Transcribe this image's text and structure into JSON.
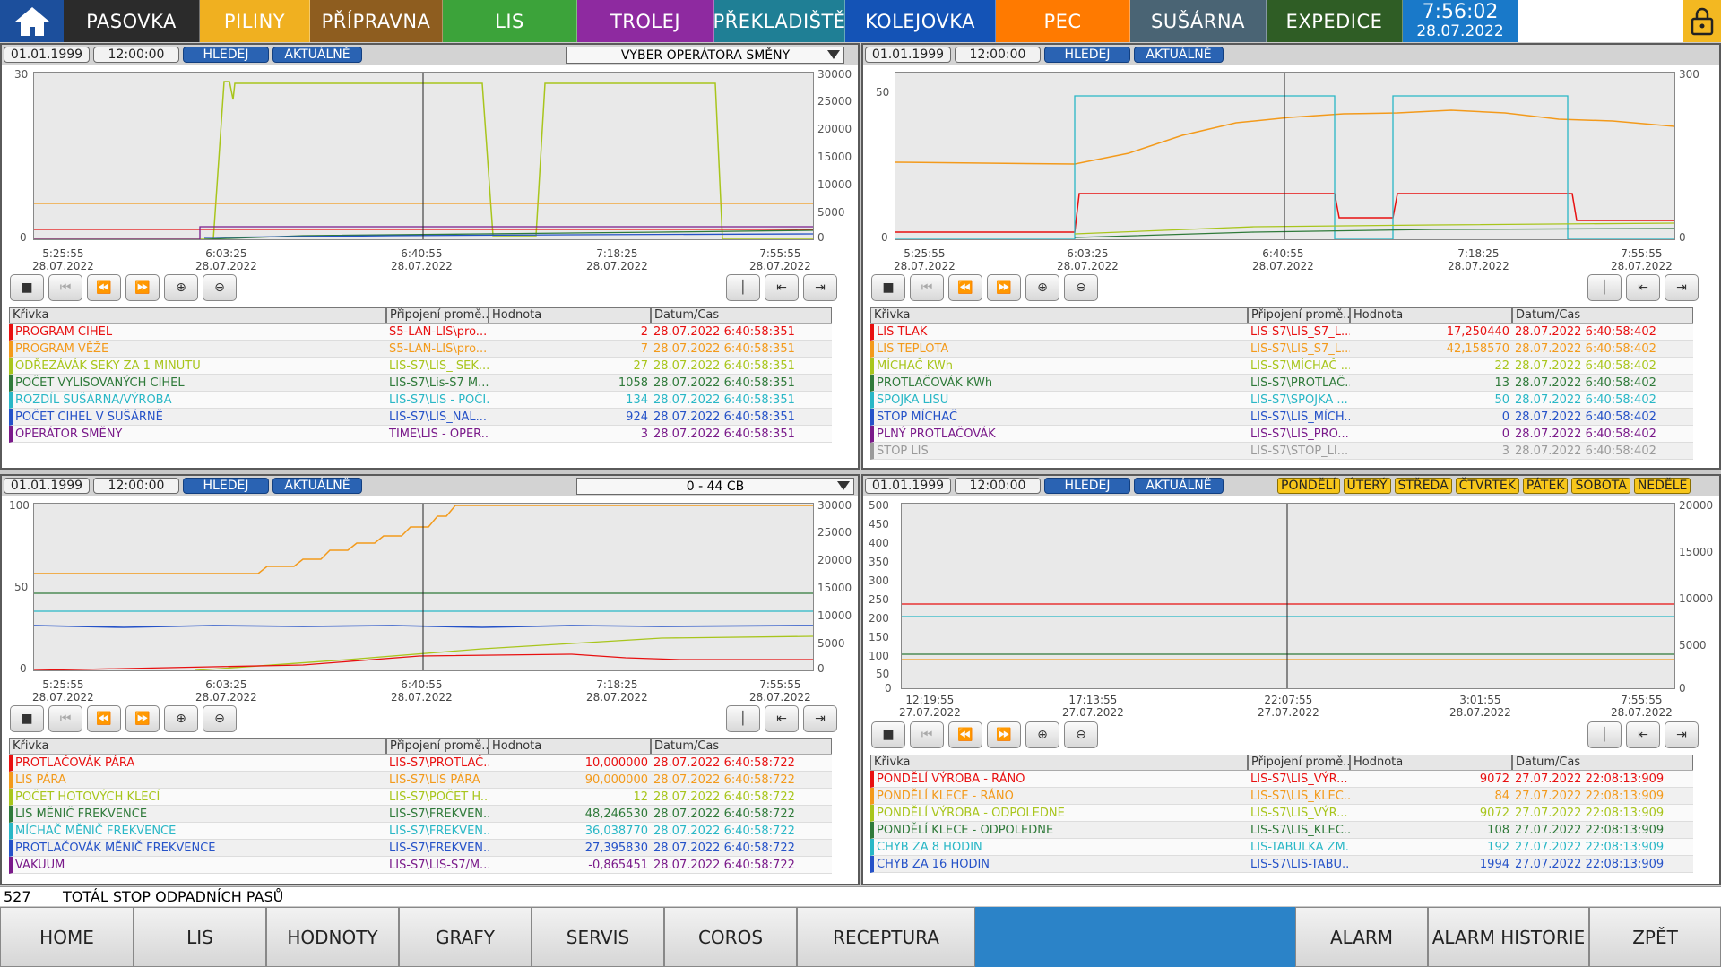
{
  "nav": {
    "tabs": [
      {
        "label": "PASOVKA",
        "color": "#2b2b2b"
      },
      {
        "label": "PILINY",
        "color": "#f0b020"
      },
      {
        "label": "PŘÍPRAVNA",
        "color": "#8e5d1f"
      },
      {
        "label": "LIS",
        "color": "#3ca33a"
      },
      {
        "label": "TROLEJ",
        "color": "#8e2aa0"
      },
      {
        "label": "PŘEKLADIŠTĚ",
        "color": "#1f7f95"
      },
      {
        "label": "KOLEJOVKA",
        "color": "#1453b6"
      },
      {
        "label": "PEC",
        "color": "#ff7a00"
      },
      {
        "label": "SUŠÁRNA",
        "color": "#4a6474"
      },
      {
        "label": "EXPEDICE",
        "color": "#2f5d25"
      }
    ],
    "time": "7:56:02",
    "date": "28.07.2022"
  },
  "panels": [
    {
      "date": "01.01.1999",
      "time": "12:00:00",
      "search": "HLEDEJ",
      "current": "AKTUÁLNĚ",
      "combo": "VYBER OPERÁTORA SMĚNY",
      "yleft": [
        "30",
        "0"
      ],
      "yright": [
        "30000",
        "25000",
        "20000",
        "15000",
        "10000",
        "5000",
        "0"
      ],
      "xticks": [
        {
          "t": "5:25:55",
          "d": "28.07.2022"
        },
        {
          "t": "6:03:25",
          "d": "28.07.2022"
        },
        {
          "t": "6:40:55",
          "d": "28.07.2022"
        },
        {
          "t": "7:18:25",
          "d": "28.07.2022"
        },
        {
          "t": "7:55:55",
          "d": "28.07.2022"
        }
      ],
      "headers": [
        "Křivka",
        "Připojení promě...",
        "Hodnota",
        "Datum/Čas"
      ],
      "rows": [
        {
          "name": "PROGRAM CIHEL",
          "conn": "S5-LAN-LIS\\pro...",
          "val": "2",
          "dt": "28.07.2022 6:40:58:351",
          "color": "#e81010"
        },
        {
          "name": "PROGRAM VĚŽE",
          "conn": "S5-LAN-LIS\\pro...",
          "val": "7",
          "dt": "28.07.2022 6:40:58:351",
          "color": "#f39a1b"
        },
        {
          "name": "ODŘEZÁVÁK SEKY ZA 1 MINUTU",
          "conn": "LIS-S7\\LIS_ SEK...",
          "val": "27",
          "dt": "28.07.2022 6:40:58:351",
          "color": "#a8c51c"
        },
        {
          "name": "POČET VYLISOVANÝCH CIHEL",
          "conn": "LIS-S7\\Lis-S7 M...",
          "val": "1058",
          "dt": "28.07.2022 6:40:58:351",
          "color": "#2f7a3a"
        },
        {
          "name": "ROZDÍL SUŠÁRNA/VÝROBA",
          "conn": "LIS-S7\\LIS - POČI...",
          "val": "134",
          "dt": "28.07.2022 6:40:58:351",
          "color": "#29b7c6"
        },
        {
          "name": "POČET CIHEL V SUŠÁRNĚ",
          "conn": "LIS-S7\\LIS_NAL...",
          "val": "924",
          "dt": "28.07.2022 6:40:58:351",
          "color": "#2552c8"
        },
        {
          "name": "OPERÁTOR SMĚNY",
          "conn": "TIME\\LIS - OPER...",
          "val": "3",
          "dt": "28.07.2022 6:40:58:351",
          "color": "#7a1a8a"
        }
      ]
    },
    {
      "date": "01.01.1999",
      "time": "12:00:00",
      "search": "HLEDEJ",
      "current": "AKTUÁLNĚ",
      "yleft": [
        "50",
        "0"
      ],
      "yright": [
        "300",
        "0"
      ],
      "xticks": [
        {
          "t": "5:25:55",
          "d": "28.07.2022"
        },
        {
          "t": "6:03:25",
          "d": "28.07.2022"
        },
        {
          "t": "6:40:55",
          "d": "28.07.2022"
        },
        {
          "t": "7:18:25",
          "d": "28.07.2022"
        },
        {
          "t": "7:55:55",
          "d": "28.07.2022"
        }
      ],
      "headers": [
        "Křivka",
        "Připojení promě...",
        "Hodnota",
        "Datum/Čas"
      ],
      "rows": [
        {
          "name": "LIS TLAK",
          "conn": "LIS-S7\\LIS_S7_L...",
          "val": "17,250440",
          "dt": "28.07.2022 6:40:58:402",
          "color": "#e81010"
        },
        {
          "name": "LIS TEPLOTA",
          "conn": "LIS-S7\\LIS_S7_L...",
          "val": "42,158570",
          "dt": "28.07.2022 6:40:58:402",
          "color": "#f39a1b"
        },
        {
          "name": "MÍCHAČ KWh",
          "conn": "LIS-S7\\MÍCHAČ ...",
          "val": "22",
          "dt": "28.07.2022 6:40:58:402",
          "color": "#a8c51c"
        },
        {
          "name": "PROTLAČOVÁK KWh",
          "conn": "LIS-S7\\PROTLAČ...",
          "val": "13",
          "dt": "28.07.2022 6:40:58:402",
          "color": "#2f7a3a"
        },
        {
          "name": "SPOJKA LISU",
          "conn": "LIS-S7\\SPOJKA ...",
          "val": "50",
          "dt": "28.07.2022 6:40:58:402",
          "color": "#29b7c6"
        },
        {
          "name": "STOP MÍCHAČ",
          "conn": "LIS-S7\\LIS_MÍCH...",
          "val": "0",
          "dt": "28.07.2022 6:40:58:402",
          "color": "#2552c8"
        },
        {
          "name": "PLNÝ PROTLAČOVÁK",
          "conn": "LIS-S7\\LIS_PRO...",
          "val": "0",
          "dt": "28.07.2022 6:40:58:402",
          "color": "#7a1a8a"
        },
        {
          "name": "STOP LIS",
          "conn": "LIS-S7\\STOP_LI...",
          "val": "3",
          "dt": "28.07.2022 6:40:58:402",
          "color": "#9a9a9a"
        }
      ]
    },
    {
      "date": "01.01.1999",
      "time": "12:00:00",
      "search": "HLEDEJ",
      "current": "AKTUÁLNĚ",
      "combo": "0 - 44 CB",
      "yleft": [
        "100",
        "50",
        "0"
      ],
      "yright": [
        "30000",
        "25000",
        "20000",
        "15000",
        "10000",
        "5000",
        "0"
      ],
      "xticks": [
        {
          "t": "5:25:55",
          "d": "28.07.2022"
        },
        {
          "t": "6:03:25",
          "d": "28.07.2022"
        },
        {
          "t": "6:40:55",
          "d": "28.07.2022"
        },
        {
          "t": "7:18:25",
          "d": "28.07.2022"
        },
        {
          "t": "7:55:55",
          "d": "28.07.2022"
        }
      ],
      "headers": [
        "Křivka",
        "Připojení promě...",
        "Hodnota",
        "Datum/Čas"
      ],
      "rows": [
        {
          "name": "PROTLAČOVÁK PÁRA",
          "conn": "LIS-S7\\PROTLAČ...",
          "val": "10,000000",
          "dt": "28.07.2022 6:40:58:722",
          "color": "#e81010"
        },
        {
          "name": "LIS PÁRA",
          "conn": "LIS-S7\\LIS PÁRA",
          "val": "90,000000",
          "dt": "28.07.2022 6:40:58:722",
          "color": "#f39a1b"
        },
        {
          "name": "POČET HOTOVÝCH KLECÍ",
          "conn": "LIS-S7\\POČET H...",
          "val": "12",
          "dt": "28.07.2022 6:40:58:722",
          "color": "#a8c51c"
        },
        {
          "name": "LIS MĚNIČ FREKVENCE",
          "conn": "LIS-S7\\FREKVEN...",
          "val": "48,246530",
          "dt": "28.07.2022 6:40:58:722",
          "color": "#2f7a3a"
        },
        {
          "name": "MÍCHAČ MĚNIČ FREKVENCE",
          "conn": "LIS-S7\\FREKVEN...",
          "val": "36,038770",
          "dt": "28.07.2022 6:40:58:722",
          "color": "#29b7c6"
        },
        {
          "name": "PROTLAČOVÁK MĚNIČ FREKVENCE",
          "conn": "LIS-S7\\FREKVEN...",
          "val": "27,395830",
          "dt": "28.07.2022 6:40:58:722",
          "color": "#2552c8"
        },
        {
          "name": "VAKUUM",
          "conn": "LIS-S7\\LIS-S7/M...",
          "val": "-0,865451",
          "dt": "28.07.2022 6:40:58:722",
          "color": "#7a1a8a"
        }
      ]
    },
    {
      "date": "01.01.1999",
      "time": "12:00:00",
      "search": "HLEDEJ",
      "current": "AKTUÁLNĚ",
      "days": [
        "PONDĚLÍ",
        "ÚTERÝ",
        "STŘEDA",
        "ČTVRTEK",
        "PÁTEK",
        "SOBOTA",
        "NEDĚLE"
      ],
      "yleft": [
        "500",
        "450",
        "400",
        "350",
        "300",
        "250",
        "200",
        "150",
        "100",
        "50",
        "0"
      ],
      "yright": [
        "20000",
        "15000",
        "10000",
        "5000",
        "0"
      ],
      "xticks": [
        {
          "t": "12:19:55",
          "d": "27.07.2022"
        },
        {
          "t": "17:13:55",
          "d": "27.07.2022"
        },
        {
          "t": "22:07:55",
          "d": "27.07.2022"
        },
        {
          "t": "3:01:55",
          "d": "28.07.2022"
        },
        {
          "t": "7:55:55",
          "d": "28.07.2022"
        }
      ],
      "headers": [
        "Křivka",
        "Připojení promě...",
        "Hodnota",
        "Datum/Čas"
      ],
      "rows": [
        {
          "name": "PONDĚLÍ VÝROBA - RÁNO",
          "conn": "LIS-S7\\LIS_VÝR...",
          "val": "9072",
          "dt": "27.07.2022 22:08:13:909",
          "color": "#e81010"
        },
        {
          "name": "PONDĚLÍ KLECE - RÁNO",
          "conn": "LIS-S7\\LIS_KLEC...",
          "val": "84",
          "dt": "27.07.2022 22:08:13:909",
          "color": "#f39a1b"
        },
        {
          "name": "PONDĚLÍ VÝROBA - ODPOLEDNE",
          "conn": "LIS-S7\\LIS_VÝR...",
          "val": "9072",
          "dt": "27.07.2022 22:08:13:909",
          "color": "#a8c51c"
        },
        {
          "name": "PONDĚLÍ KLECE - ODPOLEDNE",
          "conn": "LIS-S7\\LIS_KLEC...",
          "val": "108",
          "dt": "27.07.2022 22:08:13:909",
          "color": "#2f7a3a"
        },
        {
          "name": "CHYB ZA 8 HODIN",
          "conn": "LIS-TABULKA ZM...",
          "val": "192",
          "dt": "27.07.2022 22:08:13:909",
          "color": "#29b7c6"
        },
        {
          "name": "CHYB ZA 16 HODIN",
          "conn": "LIS-S7\\LIS-TABU...",
          "val": "1994",
          "dt": "27.07.2022 22:08:13:909",
          "color": "#2552c8"
        }
      ]
    }
  ],
  "status": {
    "code": "527",
    "message": "TOTÁL STOP ODPADNÍCH PASŮ"
  },
  "bottom": {
    "left": [
      "HOME",
      "LIS",
      "HODNOTY",
      "GRAFY",
      "SERVIS",
      "COROS",
      "RECEPTURA"
    ],
    "right": [
      "ALARM",
      "ALARM HISTORIE",
      "ZPĚT"
    ]
  }
}
